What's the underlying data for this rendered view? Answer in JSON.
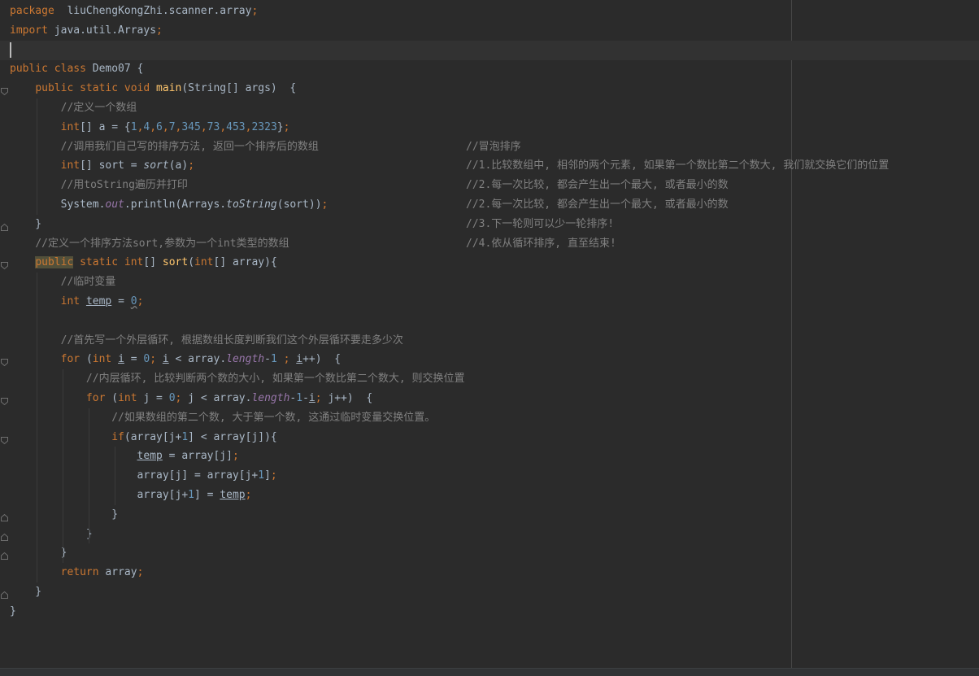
{
  "editor": {
    "colors": {
      "background": "#2b2b2b",
      "keyword": "#cc7832",
      "comment": "#808080",
      "number": "#6897bb",
      "method_declaration": "#ffc66d",
      "static_field": "#9876aa",
      "default_text": "#a9b7c6"
    },
    "lines": [
      {
        "tokens": [
          [
            "kw",
            "package"
          ],
          [
            "",
            "  liuChengKongZhi.scanner.array"
          ],
          [
            "kw",
            ";"
          ]
        ]
      },
      {
        "tokens": [
          [
            "kw",
            "import"
          ],
          [
            "",
            " java.util.Arrays"
          ],
          [
            "kw",
            ";"
          ]
        ]
      },
      {
        "tokens": []
      },
      {
        "tokens": [
          [
            "kw",
            "public class"
          ],
          [
            "",
            " Demo07 {"
          ]
        ]
      },
      {
        "tokens": [
          [
            "",
            "    "
          ],
          [
            "kw",
            "public static void"
          ],
          [
            "",
            " "
          ],
          [
            "fn",
            "main"
          ],
          [
            "",
            "(String[] args)  {"
          ]
        ]
      },
      {
        "tokens": [
          [
            "",
            "        "
          ],
          [
            "cm",
            "//定义一个数组"
          ]
        ]
      },
      {
        "tokens": [
          [
            "",
            "        "
          ],
          [
            "kw",
            "int"
          ],
          [
            "",
            "[] a = {"
          ],
          [
            "num",
            "1"
          ],
          [
            "kw",
            ","
          ],
          [
            "num",
            "4"
          ],
          [
            "kw",
            ","
          ],
          [
            "num",
            "6"
          ],
          [
            "kw",
            ","
          ],
          [
            "num",
            "7"
          ],
          [
            "kw",
            ","
          ],
          [
            "num",
            "345"
          ],
          [
            "kw",
            ","
          ],
          [
            "num",
            "73"
          ],
          [
            "kw",
            ","
          ],
          [
            "num",
            "453"
          ],
          [
            "kw",
            ","
          ],
          [
            "num",
            "2323"
          ],
          [
            "",
            "}"
          ],
          [
            "kw",
            ";"
          ]
        ]
      },
      {
        "tokens": [
          [
            "",
            "        "
          ],
          [
            "cm",
            "//调用我们自己写的排序方法, 返回一个排序后的数组"
          ]
        ],
        "right": "//冒泡排序"
      },
      {
        "tokens": [
          [
            "",
            "        "
          ],
          [
            "kw",
            "int"
          ],
          [
            "",
            "[] sort = "
          ],
          [
            "it",
            "sort"
          ],
          [
            "",
            "(a)"
          ],
          [
            "kw",
            ";"
          ]
        ],
        "right": "//1.比较数组中, 相邻的两个元素, 如果第一个数比第二个数大, 我们就交换它们的位置"
      },
      {
        "tokens": [
          [
            "",
            "        "
          ],
          [
            "cm",
            "//用toString遍历并打印"
          ]
        ],
        "right": "//2.每一次比较, 都会产生出一个最大, 或者最小的数"
      },
      {
        "tokens": [
          [
            "",
            "        System."
          ],
          [
            "field",
            "out"
          ],
          [
            "",
            ".println(Arrays."
          ],
          [
            "it",
            "toString"
          ],
          [
            "",
            "(sort))"
          ],
          [
            "kw",
            ";"
          ]
        ],
        "right": "//2.每一次比较, 都会产生出一个最大, 或者最小的数"
      },
      {
        "tokens": [
          [
            "",
            "    }"
          ]
        ],
        "right": "//3.下一轮则可以少一轮排序!"
      },
      {
        "tokens": [
          [
            "",
            "    "
          ],
          [
            "cm",
            "//定义一个排序方法sort,参数为一个int类型的数组"
          ]
        ],
        "right": "//4.依从循环排序, 直至结束!"
      },
      {
        "tokens": [
          [
            "",
            "    "
          ],
          [
            "kwhl",
            "public"
          ],
          [
            "",
            " "
          ],
          [
            "kw",
            "static int"
          ],
          [
            "",
            "[] "
          ],
          [
            "fn",
            "sort"
          ],
          [
            "",
            "("
          ],
          [
            "kw",
            "int"
          ],
          [
            "",
            "[] array){"
          ]
        ]
      },
      {
        "tokens": [
          [
            "",
            "        "
          ],
          [
            "cm",
            "//临时变量"
          ]
        ]
      },
      {
        "tokens": [
          [
            "",
            "        "
          ],
          [
            "kw",
            "int "
          ],
          [
            "ul",
            "temp"
          ],
          [
            "",
            " = "
          ],
          [
            "numwarn",
            "0"
          ],
          [
            "kw",
            ";"
          ]
        ]
      },
      {
        "tokens": []
      },
      {
        "tokens": [
          [
            "",
            "        "
          ],
          [
            "cm",
            "//首先写一个外层循环, 根据数组长度判断我们这个外层循环要走多少次"
          ]
        ]
      },
      {
        "tokens": [
          [
            "",
            "        "
          ],
          [
            "kw",
            "for "
          ],
          [
            "",
            "("
          ],
          [
            "kw",
            "int "
          ],
          [
            "ul",
            "i"
          ],
          [
            "",
            " = "
          ],
          [
            "num",
            "0"
          ],
          [
            "kw",
            "; "
          ],
          [
            "ul",
            "i"
          ],
          [
            "",
            " < array."
          ],
          [
            "field2",
            "length"
          ],
          [
            "",
            "-"
          ],
          [
            "num",
            "1 "
          ],
          [
            "kw",
            "; "
          ],
          [
            "ul",
            "i"
          ],
          [
            "",
            "++)  {"
          ]
        ]
      },
      {
        "tokens": [
          [
            "",
            "            "
          ],
          [
            "cm",
            "//内层循环, 比较判断两个数的大小, 如果第一个数比第二个数大, 则交换位置"
          ]
        ]
      },
      {
        "tokens": [
          [
            "",
            "            "
          ],
          [
            "kw",
            "for "
          ],
          [
            "",
            "("
          ],
          [
            "kw",
            "int "
          ],
          [
            "",
            "j = "
          ],
          [
            "num",
            "0"
          ],
          [
            "kw",
            "; "
          ],
          [
            "",
            "j < array."
          ],
          [
            "field2",
            "length"
          ],
          [
            "",
            "-"
          ],
          [
            "num",
            "1"
          ],
          [
            "",
            "-"
          ],
          [
            "ul",
            "i"
          ],
          [
            "kw",
            "; "
          ],
          [
            "",
            "j++)  {"
          ]
        ]
      },
      {
        "tokens": [
          [
            "",
            "                "
          ],
          [
            "cm",
            "//如果数组的第二个数, 大于第一个数, 这通过临时变量交换位置。"
          ]
        ]
      },
      {
        "tokens": [
          [
            "",
            "                "
          ],
          [
            "kw",
            "if"
          ],
          [
            "",
            "(array[j+"
          ],
          [
            "num",
            "1"
          ],
          [
            "",
            "] < array[j]){"
          ]
        ]
      },
      {
        "tokens": [
          [
            "",
            "                    "
          ],
          [
            "ul",
            "temp"
          ],
          [
            "",
            " = array[j]"
          ],
          [
            "kw",
            ";"
          ]
        ]
      },
      {
        "tokens": [
          [
            "",
            "                    array[j] = array[j+"
          ],
          [
            "num",
            "1"
          ],
          [
            "",
            "]"
          ],
          [
            "kw",
            ";"
          ]
        ]
      },
      {
        "tokens": [
          [
            "",
            "                    array[j+"
          ],
          [
            "num",
            "1"
          ],
          [
            "",
            "] = "
          ],
          [
            "ul",
            "temp"
          ],
          [
            "kw",
            ";"
          ]
        ]
      },
      {
        "tokens": [
          [
            "",
            "                }"
          ]
        ]
      },
      {
        "tokens": [
          [
            "",
            "            }"
          ]
        ]
      },
      {
        "tokens": [
          [
            "",
            "        }"
          ]
        ]
      },
      {
        "tokens": [
          [
            "",
            "        "
          ],
          [
            "kw",
            "return "
          ],
          [
            "",
            "array"
          ],
          [
            "kw",
            ";"
          ]
        ]
      },
      {
        "tokens": [
          [
            "",
            "    }"
          ]
        ]
      },
      {
        "tokens": [
          [
            "",
            "}"
          ]
        ]
      }
    ]
  }
}
